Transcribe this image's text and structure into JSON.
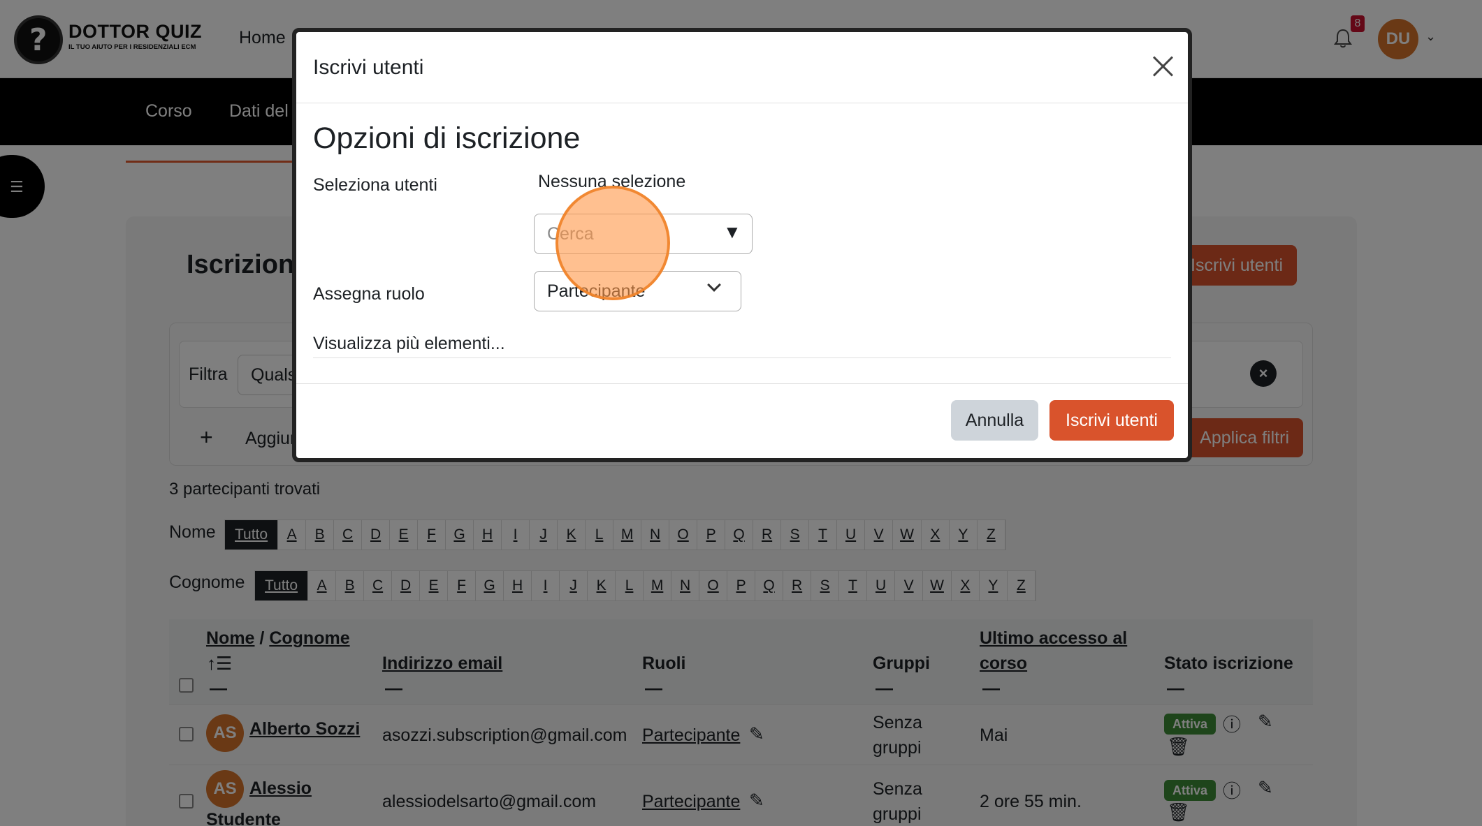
{
  "header": {
    "brand_name": "DOTTOR QUIZ",
    "brand_tagline": "IL TUO AIUTO PER I RESIDENZIALI ECM",
    "nav_home": "Home",
    "notifications_count": "8",
    "user_initials": "DU"
  },
  "secondary_nav": {
    "items": [
      "Corso",
      "Dati del"
    ]
  },
  "page": {
    "title": "Iscrizioni",
    "enrol_button": "Iscrivi utenti",
    "filter": {
      "label": "Filtra",
      "select_value": "Qualsiasi",
      "add_label": "Aggiungi",
      "apply_button": "Applica filtri"
    },
    "found_text": "3 partecipanti trovati",
    "initials": {
      "first_label": "Nome",
      "last_label": "Cognome",
      "all": "Tutto",
      "letters": [
        "A",
        "B",
        "C",
        "D",
        "E",
        "F",
        "G",
        "H",
        "I",
        "J",
        "K",
        "L",
        "M",
        "N",
        "O",
        "P",
        "Q",
        "R",
        "S",
        "T",
        "U",
        "V",
        "W",
        "X",
        "Y",
        "Z"
      ]
    },
    "table": {
      "headers": {
        "name": "Nome",
        "separator": "/",
        "surname": "Cognome",
        "email": "Indirizzo email",
        "roles": "Ruoli",
        "groups": "Gruppi",
        "last_access_line1": "Ultimo accesso al",
        "last_access_line2": "corso",
        "status": "Stato iscrizione",
        "dash": "—"
      },
      "rows": [
        {
          "initials": "AS",
          "name": "Alberto Sozzi",
          "name_line2": "",
          "email": "asozzi.subscription@gmail.com",
          "role": "Partecipante",
          "groups_line1": "Senza",
          "groups_line2": "gruppi",
          "last_access": "Mai",
          "status": "Attiva"
        },
        {
          "initials": "AS",
          "name": "Alessio",
          "name_line2": "Studente",
          "email": "alessiodelsarto@gmail.com",
          "role": "Partecipante",
          "groups_line1": "Senza",
          "groups_line2": "gruppi",
          "last_access": "2 ore 55 min.",
          "status": "Attiva"
        }
      ]
    }
  },
  "modal": {
    "title": "Iscrivi utenti",
    "section_title": "Opzioni di iscrizione",
    "select_users_label": "Seleziona utenti",
    "no_selection": "Nessuna selezione",
    "search_placeholder": "Cerca",
    "assign_role_label": "Assegna ruolo",
    "role_value": "Partecipante",
    "show_more": "Visualizza più elementi...",
    "cancel_button": "Annulla",
    "submit_button": "Iscrivi utenti"
  },
  "colors": {
    "accent": "#d9532c",
    "active_badge": "#3d8b37",
    "avatar": "#d4722a"
  }
}
